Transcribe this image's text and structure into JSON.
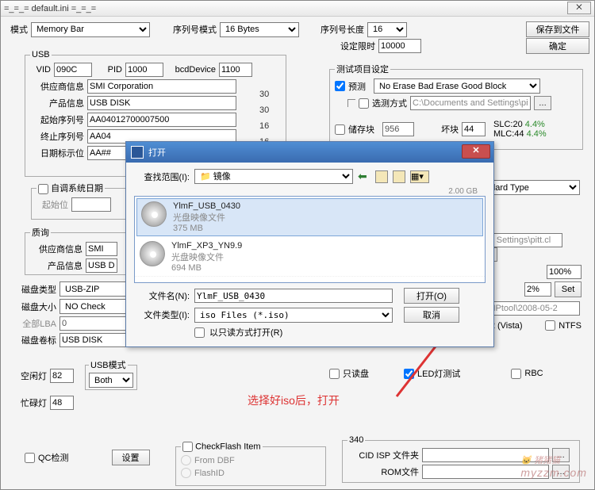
{
  "main": {
    "title": "=_=_=  default.ini  =_=_=",
    "mode_lbl": "模式",
    "mode_val": "Memory Bar",
    "serial_mode_lbl": "序列号模式",
    "serial_mode_val": "16 Bytes",
    "serial_len_lbl": "序列号长度",
    "serial_len_val": "16",
    "save_file_btn": "保存到文件",
    "time_limit_lbl": "设定限时",
    "time_limit_val": "10000",
    "confirm_btn": "确定"
  },
  "usb": {
    "legend": "USB",
    "vid_lbl": "VID",
    "vid_val": "090C",
    "pid_lbl": "PID",
    "pid_val": "1000",
    "bcd_lbl": "bcdDevice",
    "bcd_val": "1100",
    "vendor_lbl": "供应商信息",
    "vendor_val": "SMI Corporation",
    "product_lbl": "产品信息",
    "product_val": "USB DISK",
    "start_sn_lbl": "起始序列号",
    "start_sn_val": "AA04012700007500",
    "end_sn_lbl": "终止序列号",
    "end_sn_val": "AA04",
    "date_lbl": "日期标示位",
    "date_val": "AA##",
    "side_nums": [
      "30",
      "30",
      "16",
      "16"
    ]
  },
  "test_set": {
    "legend": "测试项目设定",
    "pretest_lbl": "预测",
    "pretest_sel": "No Erase Bad Erase Good Block",
    "select_way_lbl": "选测方式",
    "path_val": "C:\\Documents and Settings\\pitt",
    "store_lbl": "储存块",
    "store_val": "956",
    "bad_lbl": "坏块",
    "bad_val": "44",
    "slc": "SLC:20",
    "slc_pct": "4.4%",
    "mlc": "MLC:44",
    "mlc_pct": "4.4%",
    "standard_type": "ndard Type",
    "ind_settings": "ind Settings\\pitt.cl",
    "pct100": "100%",
    "pct2": "2%",
    "set_btn": "Set",
    "amptool": "AMPtool\\2008-05-2",
    "fat32": "T32 (Vista)",
    "ntfs_lbl": "NTFS"
  },
  "auto_date": {
    "legend": "自调系统日期",
    "start_lbl": "起始位"
  },
  "quality": {
    "legend": "质询",
    "vendor_lbl": "供应商信息",
    "vendor_val": "SMI",
    "product_lbl": "产品信息",
    "product_val": "USB D"
  },
  "disk": {
    "type_lbl": "磁盘类型",
    "type_val": "USB-ZIP",
    "size_lbl": "磁盘大小",
    "size_val": "NO Check",
    "all_lba_lbl": "全部LBA",
    "all_lba_val": "0",
    "label_lbl": "磁盘卷标",
    "label_val": "USB DISK",
    "idle_lbl": "空闲灯",
    "idle_val": "82",
    "busy_lbl": "忙碌灯",
    "busy_val": "48",
    "usbmode_legend": "USB模式",
    "usbmode_val": "Both"
  },
  "checks": {
    "readonly_lbl": "只读盘",
    "ledtest_lbl": "LED灯测试",
    "rbc_lbl": "RBC",
    "qc_lbl": "QC检测",
    "set_btn": "设置"
  },
  "checkflash": {
    "legend": "CheckFlash Item",
    "from_dbf": "From DBF",
    "flashid": "FlashID"
  },
  "g340": {
    "legend": "340",
    "cid_lbl": "CID ISP 文件夹",
    "rom_lbl": "ROM文件"
  },
  "dlg": {
    "title": "打开",
    "range_lbl": "查找范围(I):",
    "range_val": "镜像",
    "files": [
      {
        "name": "YlmF_USB_0430",
        "desc": "光盘映像文件",
        "size": "375 MB",
        "sel": true
      },
      {
        "name": "YlmF_XP3_YN9.9",
        "desc": "光盘映像文件",
        "size": "694 MB",
        "sel": false
      }
    ],
    "filename_lbl": "文件名(N):",
    "filename_val": "YlmF_USB_0430",
    "filetype_lbl": "文件类型(I):",
    "filetype_val": "iso Files (*.iso)",
    "readonly_lbl": "以只读方式打开(R)",
    "open_btn": "打开(O)",
    "cancel_btn": "取消",
    "small_size": "2.00 GB"
  },
  "annotation": "选择好iso后，打开",
  "logo": "猪猪猫\nmyzzm.com"
}
